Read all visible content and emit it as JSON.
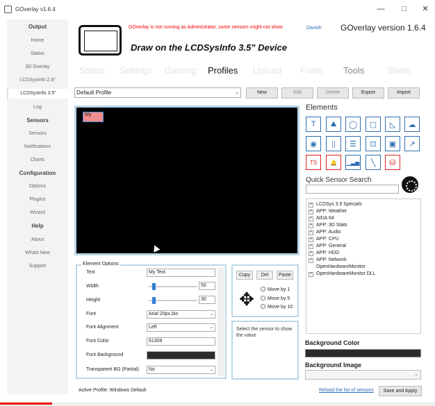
{
  "window": {
    "title": "GOverlay v1.6.4",
    "minimize": "—",
    "maximize": "□",
    "close": "✕"
  },
  "sidebar": {
    "items": [
      {
        "label": "Output",
        "kind": "head"
      },
      {
        "label": "Home"
      },
      {
        "label": "Status"
      },
      {
        "label": "3D Overlay"
      },
      {
        "label": "LCDSysInfo 2.8\""
      },
      {
        "label": "LCDSysInfo 3.5\"",
        "active": true
      },
      {
        "label": "Log"
      },
      {
        "label": "Sensors",
        "kind": "head"
      },
      {
        "label": "Sensors"
      },
      {
        "label": "Notifications"
      },
      {
        "label": "Charts"
      },
      {
        "label": "Configuration",
        "kind": "head"
      },
      {
        "label": "Options"
      },
      {
        "label": "Plugins"
      },
      {
        "label": "Wizard"
      },
      {
        "label": "Help",
        "kind": "head"
      },
      {
        "label": "About"
      },
      {
        "label": "Whats New"
      },
      {
        "label": "Support"
      }
    ]
  },
  "header": {
    "warning": "GOverlay is not running as Administrator, some sensors might not show",
    "language": "Danish",
    "version": "GOverlay version 1.6.4",
    "device_title": "Draw on the LCDSysInfo 3.5\" Device",
    "device_icon": "tablet-icon"
  },
  "tabs": [
    "Status",
    "Settings",
    "Gaming",
    "Profiles",
    "Upload",
    "Fonts",
    "Tools",
    "Share"
  ],
  "active_tab": "Profiles",
  "profile_bar": {
    "selected": "Default Profile",
    "buttons": {
      "new": "New",
      "edit": "Edit",
      "delete": "Delete",
      "export": "Export",
      "import": "Import"
    }
  },
  "canvas": {
    "element_label": "My"
  },
  "elements": {
    "title": "Elements",
    "icons": [
      {
        "name": "text-icon",
        "glyph": "T"
      },
      {
        "name": "image-icon",
        "glyph": "⛰"
      },
      {
        "name": "circle-icon",
        "glyph": "◯"
      },
      {
        "name": "rectangle-icon",
        "glyph": "▢"
      },
      {
        "name": "triangle-icon",
        "glyph": "◺"
      },
      {
        "name": "weather-icon",
        "glyph": "☁"
      },
      {
        "name": "gauge-icon",
        "glyph": "◉"
      },
      {
        "name": "battery-icon",
        "glyph": "▯"
      },
      {
        "name": "equalizer-icon",
        "glyph": "☰"
      },
      {
        "name": "crop-icon",
        "glyph": "⊡"
      },
      {
        "name": "picture-icon",
        "glyph": "▣"
      },
      {
        "name": "graph-icon",
        "glyph": "↗"
      },
      {
        "name": "ts-icon",
        "glyph": "TS",
        "red": true
      },
      {
        "name": "bell-icon",
        "glyph": "🔔",
        "red": true
      },
      {
        "name": "signal-icon",
        "glyph": "▁▃▅"
      },
      {
        "name": "line-icon",
        "glyph": "╲"
      },
      {
        "name": "database-icon",
        "glyph": "⛁",
        "red": true
      }
    ]
  },
  "quick_sensor": {
    "title": "Quick Sensor Search",
    "value": "",
    "icon": "dial-icon"
  },
  "sensor_tree": [
    {
      "label": "LCDSys 3.5 Specials",
      "expandable": true
    },
    {
      "label": "APP: Weather",
      "expandable": true
    },
    {
      "label": "AIDA 64",
      "expandable": true
    },
    {
      "label": "APP: 3D Stats",
      "expandable": true
    },
    {
      "label": "APP: Audio",
      "expandable": true
    },
    {
      "label": "APP: CPU",
      "expandable": true
    },
    {
      "label": "APP: General",
      "expandable": true
    },
    {
      "label": "APP: HDD",
      "expandable": true
    },
    {
      "label": "APP: Network",
      "expandable": true
    },
    {
      "label": "OpenHardwareMonitor",
      "expandable": false
    },
    {
      "label": "OpenHardwareMonitor DLL",
      "expandable": true
    }
  ],
  "background": {
    "color_title": "Background Color",
    "color": "#2b2b2b",
    "image_title": "Background Image",
    "image_value": ""
  },
  "element_options": {
    "title": "Element Options",
    "text_label": "Text",
    "text_value": "My Text",
    "width_label": "Width",
    "width_value": "50",
    "width_slider": 0.08,
    "height_label": "Height",
    "height_value": "30",
    "height_slider": 0.08,
    "font_label": "Font",
    "font_value": "Arial 20px.bin",
    "align_label": "Font Alignment",
    "align_value": "Left",
    "color_label": "Font Color",
    "color_value": "61309",
    "bg_label": "Font Background",
    "bg_color": "#2b2b2b",
    "transp_label": "Transparent BG (Partial)",
    "transp_value": "No"
  },
  "move": {
    "copy": "Copy",
    "del": "Del",
    "paste": "Paste",
    "opt1": "Move by 1",
    "opt5": "Move by 5",
    "opt10": "Move by 10",
    "icon": "move-arrows-icon"
  },
  "hint": "Select the sensor to show the value",
  "footer": {
    "active_profile": "Active Profile: Windows Default",
    "reload": "Reload the list of sensors",
    "save": "Save and Apply"
  },
  "video_progress": 0.12
}
